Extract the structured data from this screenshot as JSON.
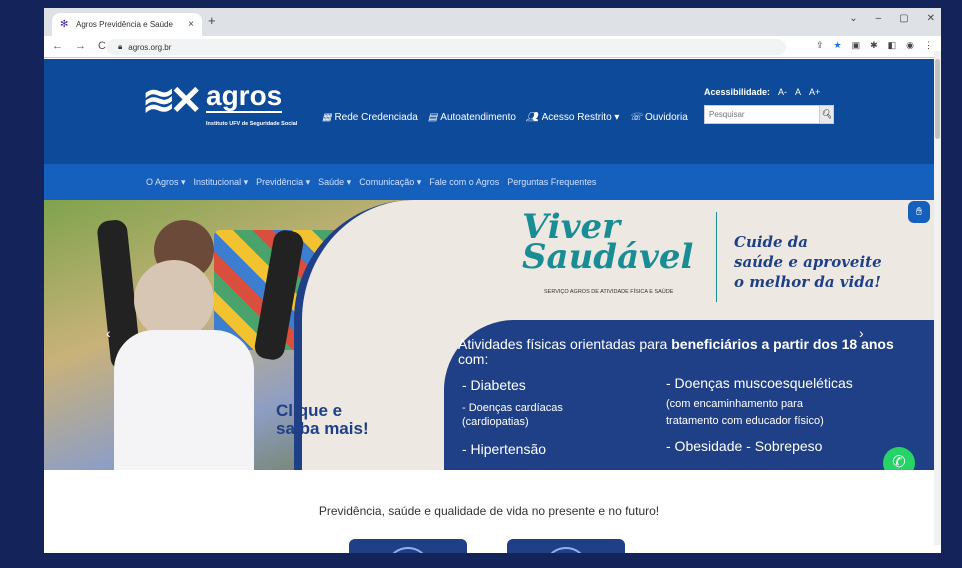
{
  "browser": {
    "tab_title": "Agros Previdência e Saúde",
    "tab_close": "×",
    "new_tab": "+",
    "url": "agros.org.br",
    "nav_back": "←",
    "nav_forward": "→",
    "nav_reload": "C",
    "win_min": "–",
    "win_restore": "▢",
    "win_close": "✕",
    "win_menu": "⌄"
  },
  "header": {
    "logo_name": "agros",
    "logo_sub": "Instituto UFV de Seguridade Social",
    "links": [
      "Rede Credenciada",
      "Autoatendimento",
      "Acesso Restrito ▾",
      "Ouvidoria"
    ],
    "accessibility_label": "Acessibilidade:",
    "acc_options": [
      "A-",
      "A",
      "A+"
    ],
    "search_placeholder": "Pesquisar"
  },
  "menu": {
    "items": [
      "O Agros ▾",
      "Institucional ▾",
      "Previdência ▾",
      "Saúde ▾",
      "Comunicação ▾",
      "Fale com o Agros",
      "Perguntas Frequentes"
    ]
  },
  "hero": {
    "cta_line1": "Clique e",
    "cta_line2": "saiba mais!",
    "brand_line1": "Viver",
    "brand_line2": "Saudável",
    "brand_sub": "SERVIÇO AGROS DE ATIVIDADE FÍSICA E SAÚDE",
    "slogan_line1": "Cuide da",
    "slogan_line2": "saúde e aproveite",
    "slogan_line3": "o melhor da vida!",
    "panel_title_a": "Atividades físicas orientadas para ",
    "panel_title_b": "beneficiários a partir dos 18 anos",
    "panel_title_c": " com:",
    "items_left": [
      "- Diabetes",
      "- Doenças cardíacas",
      "(cardiopatias)",
      "- Hipertensão"
    ],
    "items_right_1": "- Doenças muscoesqueléticas",
    "items_right_2": "(com encaminhamento para",
    "items_right_3": "tratamento com educador físico)",
    "items_right_4": "- Obesidade   - Sobrepeso",
    "prev": "‹",
    "next": "›"
  },
  "tagline": "Previdência, saúde e qualidade de vida no presente e no futuro!",
  "colors": {
    "header_bg": "#0d4a9a",
    "menu_bg": "#1560bd",
    "panel_bg": "#1f3f86",
    "whatsapp": "#25d366"
  }
}
